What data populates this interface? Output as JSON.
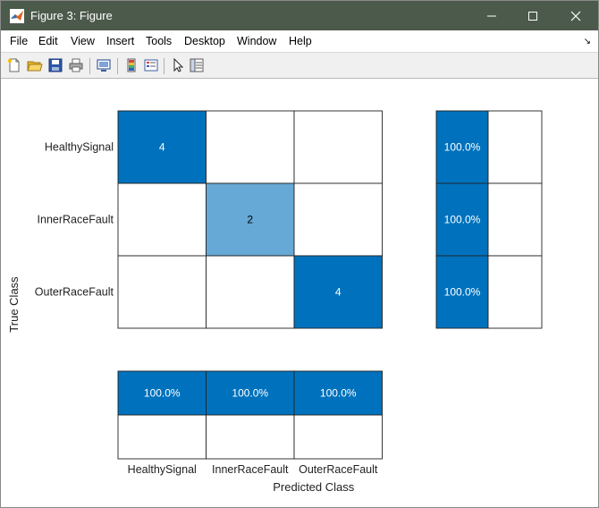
{
  "window": {
    "title": "Figure 3: Figure",
    "title_bar_color": "#4c5a4c"
  },
  "menu": {
    "items": [
      "File",
      "Edit",
      "View",
      "Insert",
      "Tools",
      "Desktop",
      "Window",
      "Help"
    ]
  },
  "toolbar": {
    "icons": [
      "new-figure-icon",
      "open-file-icon",
      "save-icon",
      "print-icon",
      "link-plot-icon",
      "insert-colorbar-icon",
      "insert-legend-icon",
      "edit-plot-icon",
      "property-inspector-icon"
    ]
  },
  "chart_data": {
    "type": "heatmap",
    "xlabel": "Predicted Class",
    "ylabel": "True Class",
    "classes": [
      "HealthySignal",
      "InnerRaceFault",
      "OuterRaceFault"
    ],
    "matrix": [
      [
        4,
        0,
        0
      ],
      [
        0,
        2,
        0
      ],
      [
        0,
        0,
        4
      ]
    ],
    "cell_labels": [
      [
        "4",
        "",
        ""
      ],
      [
        "",
        "2",
        ""
      ],
      [
        "",
        "",
        "4"
      ]
    ],
    "row_summary": [
      {
        "correct": "100.0%",
        "incorrect": ""
      },
      {
        "correct": "100.0%",
        "incorrect": ""
      },
      {
        "correct": "100.0%",
        "incorrect": ""
      }
    ],
    "column_summary": [
      {
        "correct": "100.0%",
        "incorrect": ""
      },
      {
        "correct": "100.0%",
        "incorrect": ""
      },
      {
        "correct": "100.0%",
        "incorrect": ""
      }
    ],
    "colors": {
      "dark": "#0072bd",
      "light": "#66a8d6",
      "empty": "#ffffff"
    }
  }
}
